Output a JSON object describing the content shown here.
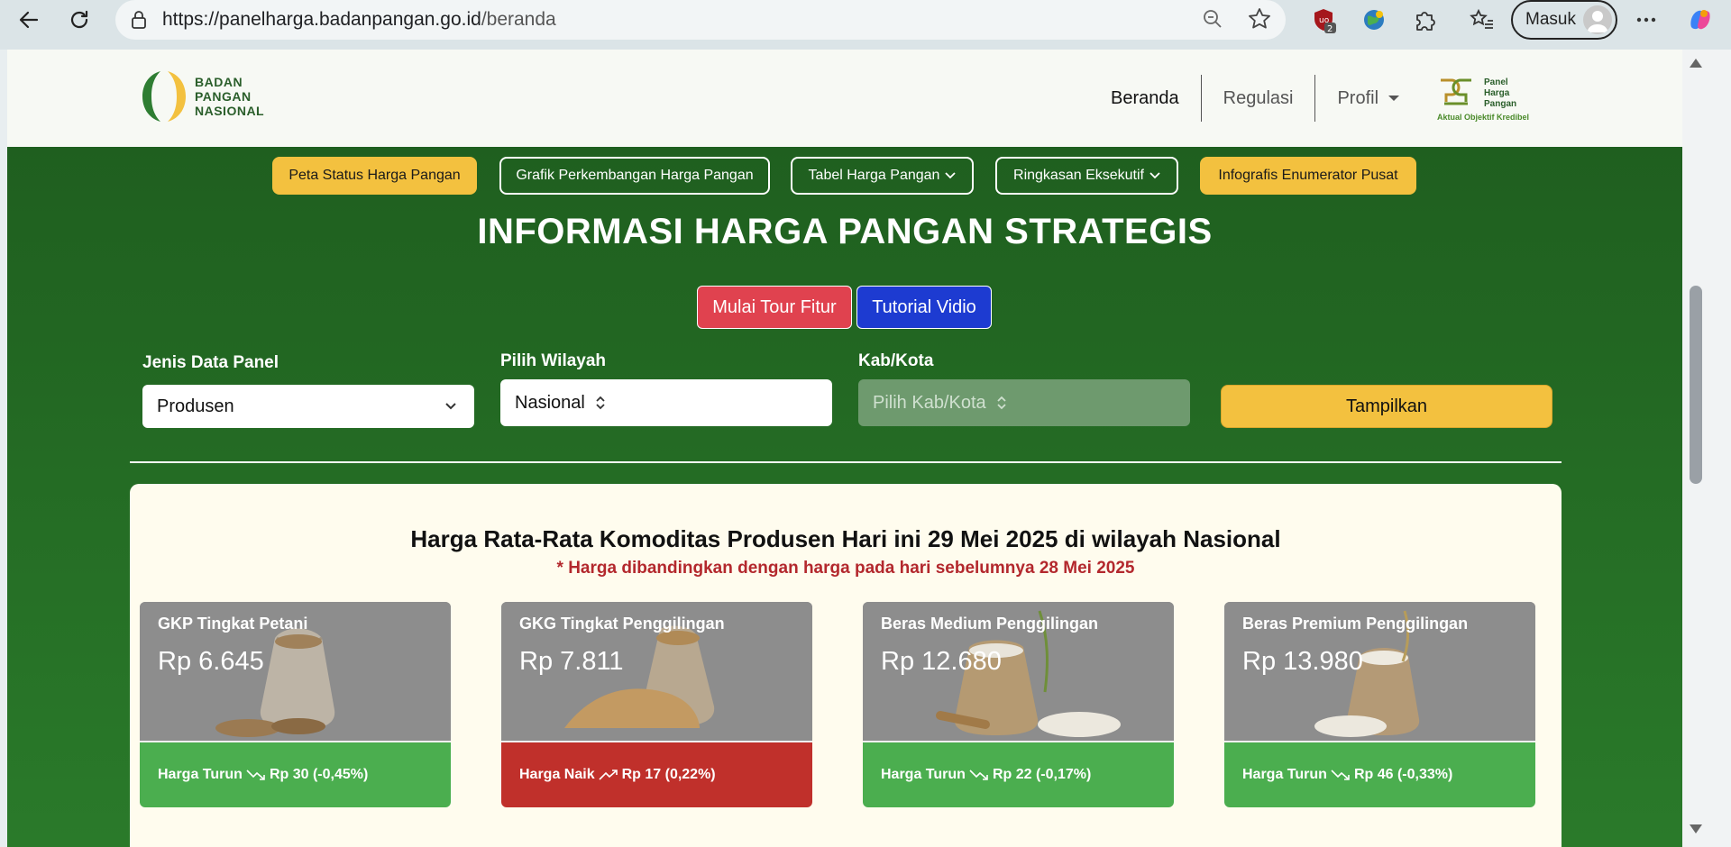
{
  "browser": {
    "url_host": "https://panelharga.badanpangan.go.id",
    "url_path": "/beranda",
    "ext_badge": "2",
    "signin_label": "Masuk"
  },
  "header": {
    "logo_line1": "BADAN",
    "logo_line2": "PANGAN",
    "logo_line3": "NASIONAL",
    "menu": [
      "Beranda",
      "Regulasi",
      "Profil"
    ],
    "php_logo_line1": "Panel",
    "php_logo_line2": "Harga",
    "php_logo_line3": "Pangan",
    "php_tagline": "Aktual Objektif Kredibel"
  },
  "pills": [
    {
      "label": "Peta Status Harga Pangan",
      "style": "yellow"
    },
    {
      "label": "Grafik Perkembangan Harga Pangan",
      "style": "outline"
    },
    {
      "label": "Tabel Harga Pangan",
      "style": "outline",
      "dropdown": true
    },
    {
      "label": "Ringkasan Eksekutif",
      "style": "outline",
      "dropdown": true
    },
    {
      "label": "Infografis Enumerator Pusat",
      "style": "yellow"
    }
  ],
  "main_title": "INFORMASI HARGA PANGAN STRATEGIS",
  "buttons": {
    "tour": "Mulai Tour Fitur",
    "video": "Tutorial Vidio",
    "show": "Tampilkan"
  },
  "filters": {
    "jenis_label": "Jenis Data Panel",
    "jenis_value": "Produsen",
    "wilayah_label": "Pilih Wilayah",
    "wilayah_value": "Nasional",
    "kab_label": "Kab/Kota",
    "kab_placeholder": "Pilih Kab/Kota"
  },
  "panel": {
    "title": "Harga Rata-Rata Komoditas Produsen Hari ini 29 Mei 2025 di wilayah Nasional",
    "subtitle": "* Harga dibandingkan dengan harga pada hari sebelumnya 28 Mei 2025"
  },
  "cards": [
    {
      "name": "GKP Tingkat Petani",
      "price": "Rp 6.645",
      "status_label": "Harga Turun",
      "change": "Rp 30 (-0,45%)",
      "direction": "down"
    },
    {
      "name": "GKG Tingkat Penggilingan",
      "price": "Rp 7.811",
      "status_label": "Harga Naik",
      "change": "Rp 17 (0,22%)",
      "direction": "up"
    },
    {
      "name": "Beras Medium Penggilingan",
      "price": "Rp 12.680",
      "status_label": "Harga Turun",
      "change": "Rp 22 (-0,17%)",
      "direction": "down"
    },
    {
      "name": "Beras Premium Penggilingan",
      "price": "Rp 13.980",
      "status_label": "Harga Turun",
      "change": "Rp 46 (-0,33%)",
      "direction": "down"
    }
  ],
  "colors": {
    "brand_green": "#2a6e2a",
    "accent_yellow": "#f3c13f",
    "down_green": "#4bae4f",
    "up_red": "#c0302b"
  }
}
